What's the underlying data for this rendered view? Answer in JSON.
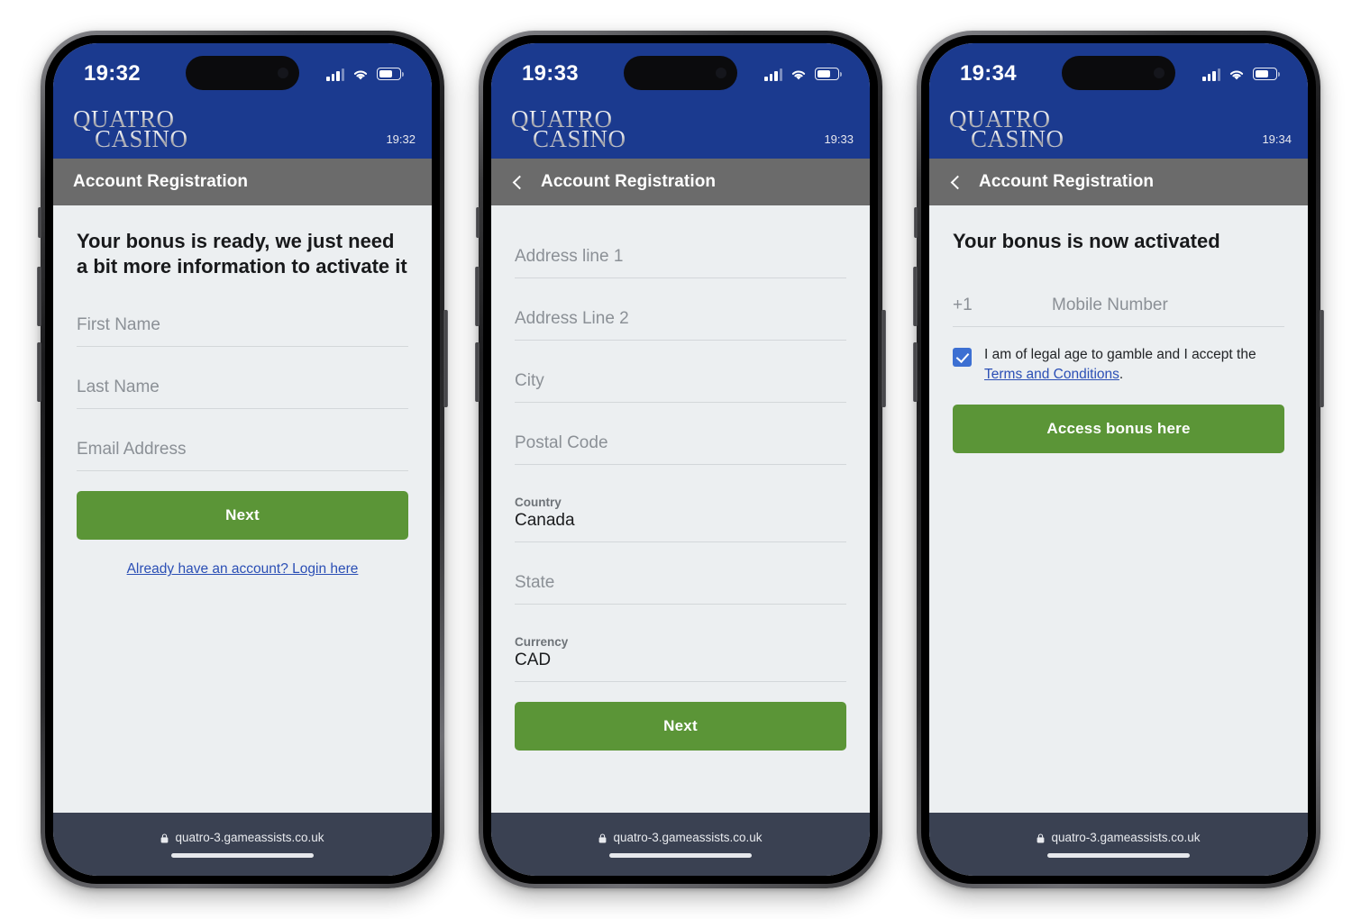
{
  "brand": {
    "line1": "QUATRO",
    "line2": "CASINO"
  },
  "browser": {
    "url": "quatro-3.gameassists.co.uk",
    "lock_icon": "lock-icon"
  },
  "colors": {
    "header_blue": "#1b3a8f",
    "title_gray": "#6b6b6b",
    "primary_green": "#5b9537",
    "link_blue": "#2b4fb5",
    "checkbox_blue": "#3c6fd2",
    "page_bg": "#eceff1",
    "urlbar": "#3a4152"
  },
  "status_icons": {
    "signal": "signal-bars-icon",
    "wifi": "wifi-icon",
    "battery": "battery-icon"
  },
  "screens": [
    {
      "status_time": "19:32",
      "brand_time": "19:32",
      "title": "Account Registration",
      "has_back": false,
      "back_icon": "chevron-left-icon",
      "heading": "Your bonus is ready, we just need a bit more information to activate it",
      "fields": [
        {
          "placeholder": "First Name"
        },
        {
          "placeholder": "Last Name"
        },
        {
          "placeholder": "Email Address"
        }
      ],
      "primary_button": "Next",
      "login_link": "Already have an account? Login here"
    },
    {
      "status_time": "19:33",
      "brand_time": "19:33",
      "title": "Account Registration",
      "has_back": true,
      "back_icon": "chevron-left-icon",
      "fields": [
        {
          "placeholder": "Address line 1"
        },
        {
          "placeholder": "Address Line 2"
        },
        {
          "placeholder": "City"
        },
        {
          "placeholder": "Postal Code"
        },
        {
          "label": "Country",
          "value": "Canada"
        },
        {
          "placeholder": "State"
        },
        {
          "label": "Currency",
          "value": "CAD"
        }
      ],
      "primary_button": "Next"
    },
    {
      "status_time": "19:34",
      "brand_time": "19:34",
      "title": "Account Registration",
      "has_back": true,
      "back_icon": "chevron-left-icon",
      "heading": "Your bonus is now activated",
      "mobile": {
        "country_code": "+1",
        "placeholder": "Mobile Number"
      },
      "consent": {
        "checked": true,
        "text_before": "I am of legal age to gamble and I accept the ",
        "link": "Terms and Conditions",
        "text_after": "."
      },
      "primary_button": "Access bonus here"
    }
  ]
}
